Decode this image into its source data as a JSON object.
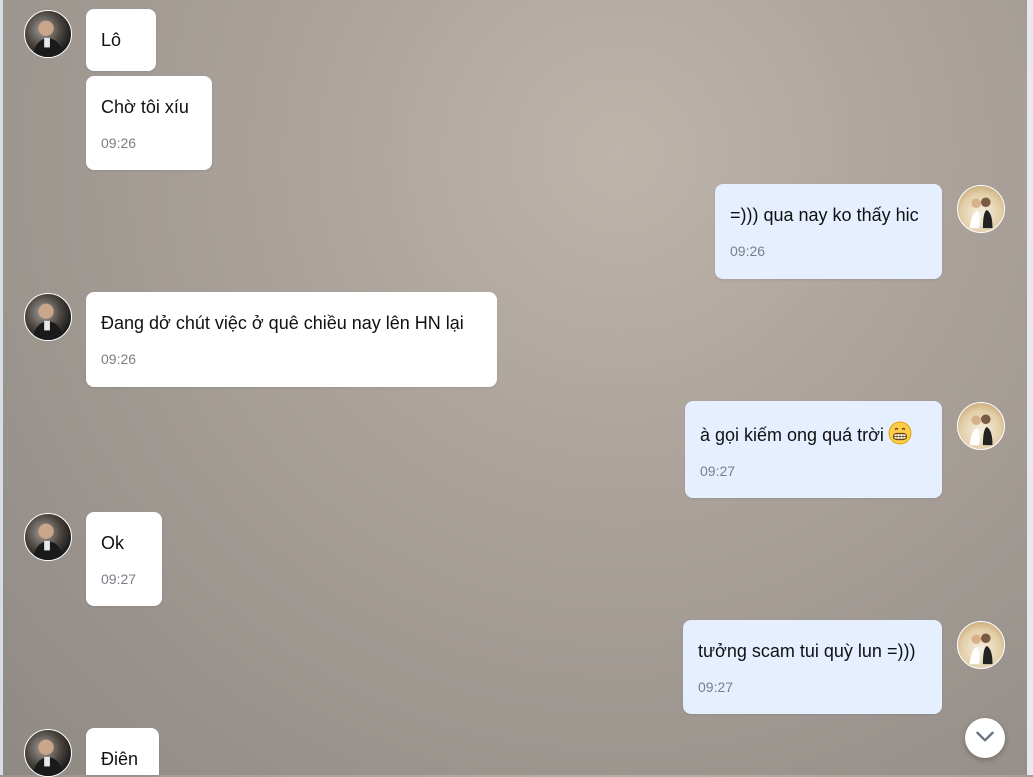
{
  "messages": [
    {
      "side": "peer",
      "text": "Lô",
      "time": ""
    },
    {
      "side": "peer",
      "text": "Chờ tôi xíu",
      "time": "09:26"
    },
    {
      "side": "me",
      "text": "=))) qua nay ko thấy hic",
      "time": "09:26"
    },
    {
      "side": "peer",
      "text": "Đang dở chút việc ở quê chiều nay lên HN lại",
      "time": "09:26"
    },
    {
      "side": "me",
      "text": "à gọi kiếm ong quá trời",
      "emoji": "grinning-face-emoji",
      "time": "09:27"
    },
    {
      "side": "peer",
      "text": "Ok",
      "time": "09:27"
    },
    {
      "side": "me",
      "text": "tưởng scam tui quỳ lun =)))",
      "time": "09:27"
    },
    {
      "side": "peer",
      "text": "Điên",
      "time": ""
    }
  ],
  "icons": {
    "scroll_down": "chevron-down-icon",
    "peer_avatar": "avatar-man-suit",
    "me_avatar": "avatar-wedding-couple"
  },
  "colors": {
    "peer_bubble": "#ffffff",
    "me_bubble": "#e5efff",
    "time_text": "#7a7f86"
  }
}
